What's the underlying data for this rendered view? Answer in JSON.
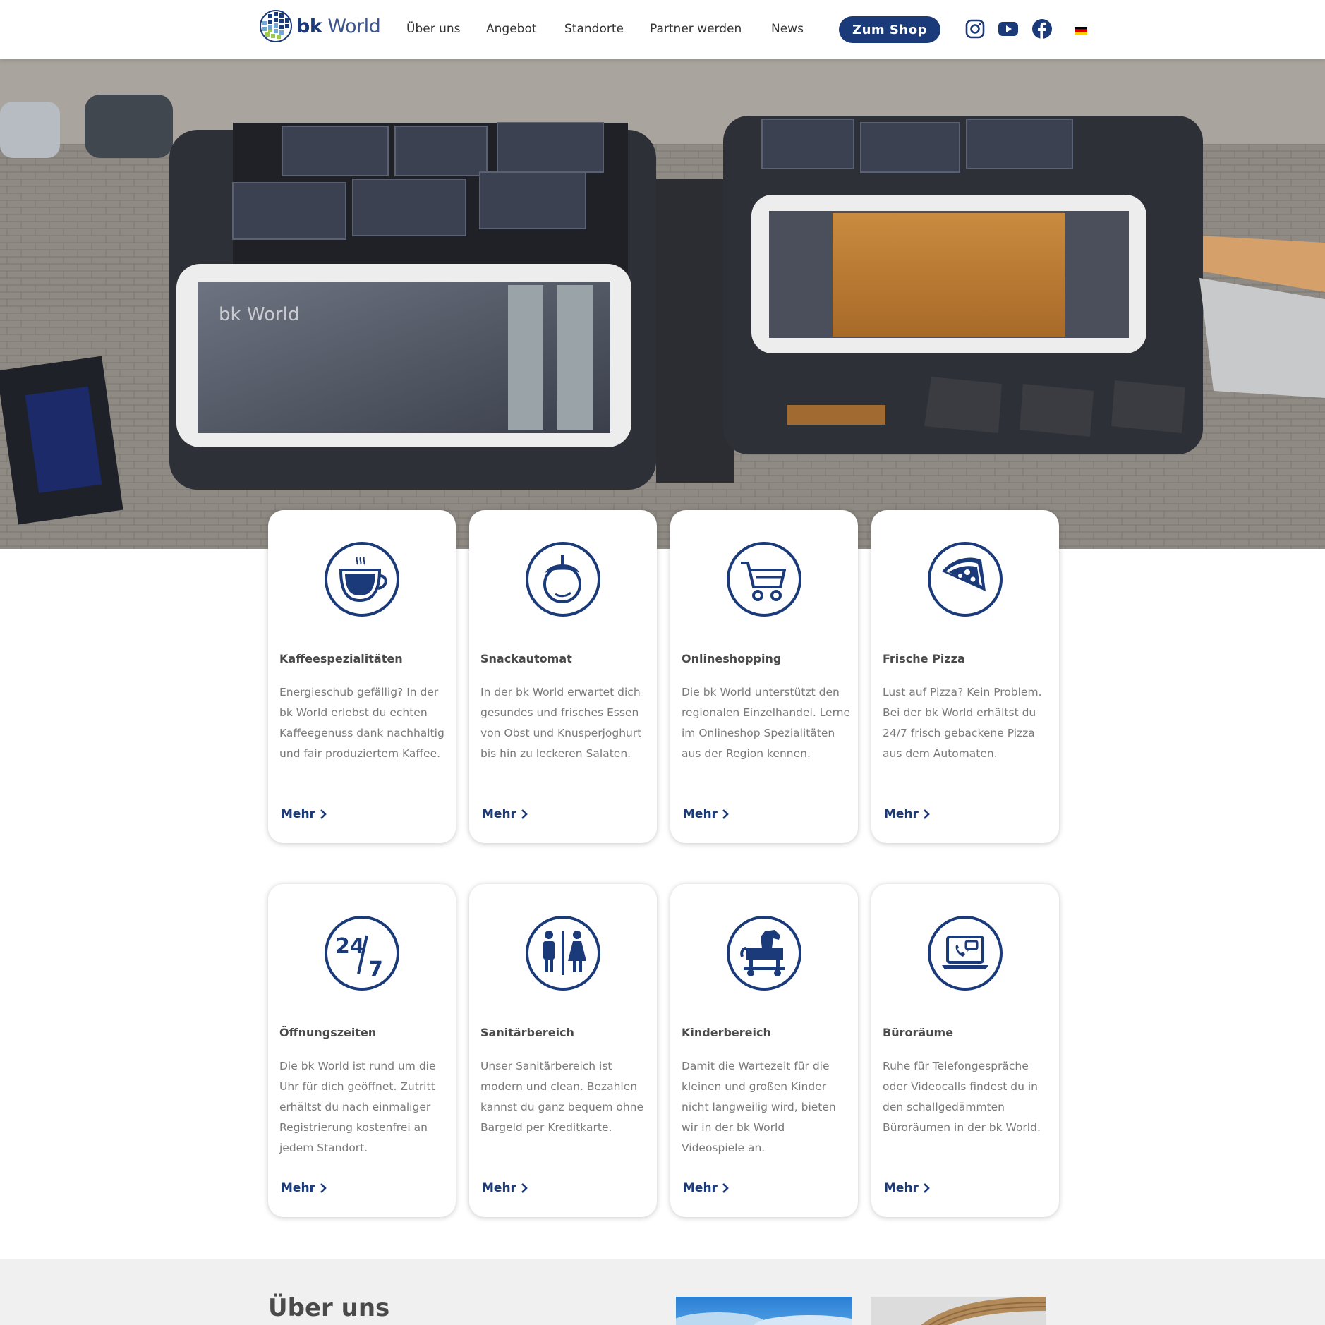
{
  "header": {
    "logo_bold": "bk",
    "logo_rest": "World",
    "nav": [
      "Über uns",
      "Angebot",
      "Standorte",
      "Partner werden",
      "News"
    ],
    "shop_label": "Zum Shop",
    "social_icons": [
      "instagram-icon",
      "youtube-icon",
      "facebook-icon"
    ],
    "language": "de-flag"
  },
  "colors": {
    "brand": "#1b3a7a",
    "text": "#4a4a4a",
    "muted": "#7a7a7a"
  },
  "hero": {
    "sign_text": "bk World"
  },
  "cards": [
    {
      "icon": "coffee-cup-icon",
      "title": "Kaffeespezialitäten",
      "text": "Energieschub gefällig? In der bk World erlebst du echten Kaffeegenuss dank nachhaltig und fair produziertem Kaffee.",
      "more": "Mehr"
    },
    {
      "icon": "fruit-icon",
      "title": "Snackautomat",
      "text": "In der bk World erwartet dich gesundes und frisches Essen von Obst und Knusperjoghurt bis hin zu leckeren Salaten.",
      "more": "Mehr"
    },
    {
      "icon": "shopping-cart-icon",
      "title": "Onlineshopping",
      "text": "Die bk World unterstützt den regionalen Einzelhandel. Lerne im Onlineshop Spezialitäten aus der Region kennen.",
      "more": "Mehr"
    },
    {
      "icon": "pizza-icon",
      "title": "Frische Pizza",
      "text": "Lust auf Pizza? Kein Problem. Bei der bk World erhältst du 24/7 frisch gebackene Pizza aus dem Automaten.",
      "more": "Mehr"
    },
    {
      "icon": "24-7-icon",
      "title": "Öffnungszeiten",
      "text": "Die bk World ist rund um die Uhr für dich geöffnet. Zutritt erhältst du nach einmaliger Registrierung kostenfrei an jedem Standort.",
      "more": "Mehr"
    },
    {
      "icon": "restroom-icon",
      "title": "Sanitärbereich",
      "text": "Unser Sanitärbereich ist modern und clean. Bezahlen kannst du ganz bequem ohne Bargeld per Kreditkarte.",
      "more": "Mehr"
    },
    {
      "icon": "rocking-horse-icon",
      "title": "Kinderbereich",
      "text": "Damit die Wartezeit für die kleinen und großen Kinder nicht langweilig wird, bieten wir in der bk World Videospiele an.",
      "more": "Mehr"
    },
    {
      "icon": "laptop-call-icon",
      "title": "Büroräume",
      "text": "Ruhe für Telefongespräche oder Videocalls findest du in den schallgedämmten Büroräumen in der bk World.",
      "more": "Mehr"
    }
  ],
  "about": {
    "title": "Über uns"
  },
  "icon_24_7": {
    "hours": "24",
    "days": "7"
  }
}
